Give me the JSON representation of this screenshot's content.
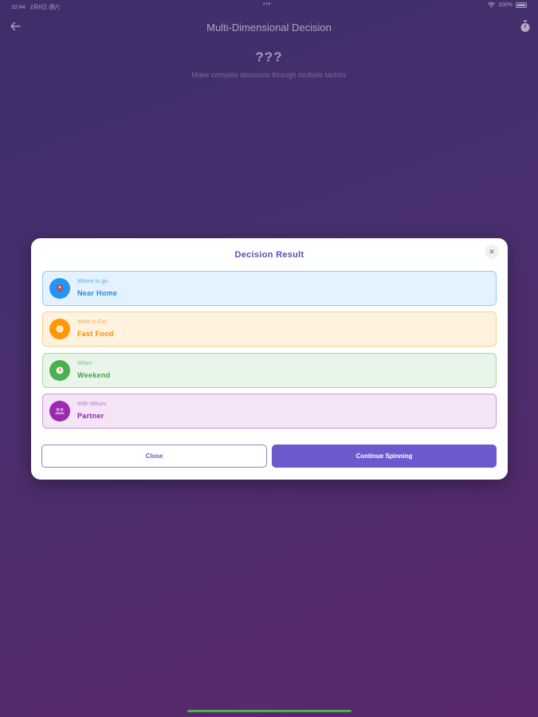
{
  "status_bar": {
    "time": "10:44",
    "date": "2月6日 週六",
    "dots": "•••",
    "battery": "100%"
  },
  "header": {
    "title": "Multi-Dimensional Decision"
  },
  "hero": {
    "title": "???",
    "subtitle": "Make complex decisions through multiple factors"
  },
  "modal": {
    "title": "Decision Result",
    "close_glyph": "✕",
    "results": [
      {
        "label": "Where to go",
        "value": "Near Home",
        "icon": "location-pin-icon",
        "color": "#2196f3"
      },
      {
        "label": "What to Eat",
        "value": "Fast Food",
        "icon": "food-icon",
        "color": "#ff9800"
      },
      {
        "label": "When",
        "value": "Weekend",
        "icon": "clock-icon",
        "color": "#4caf50"
      },
      {
        "label": "With Whom",
        "value": "Partner",
        "icon": "people-icon",
        "color": "#9c27b0"
      }
    ],
    "close_button": "Close",
    "continue_button": "Continue Spinning",
    "accent_color": "#6a5acd"
  }
}
